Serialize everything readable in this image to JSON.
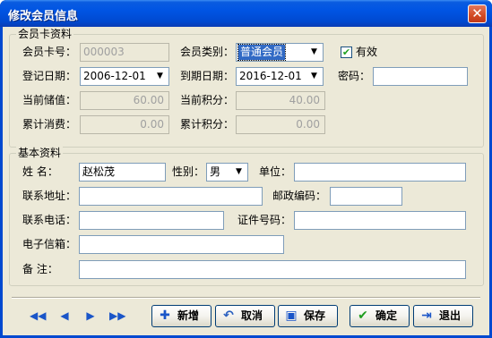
{
  "window": {
    "title": "修改会员信息",
    "close_symbol": "✕"
  },
  "card_group": {
    "title": "会员卡资料",
    "card_no_label": "会员卡号：",
    "card_no_value": "000003",
    "type_label": "会员类别：",
    "type_value": "普通会员",
    "valid_label": "有效",
    "valid_checked": true,
    "reg_date_label": "登记日期：",
    "reg_date_value": "2006-12-01",
    "expire_label": "到期日期：",
    "expire_value": "2016-12-01",
    "password_label": "密码：",
    "password_value": "",
    "balance_label": "当前储值：",
    "balance_value": "60.00",
    "points_label": "当前积分：",
    "points_value": "40.00",
    "total_spend_label": "累计消费：",
    "total_spend_value": "0.00",
    "total_points_label": "累计积分：",
    "total_points_value": "0.00"
  },
  "basic_group": {
    "title": "基本资料",
    "name_label": "姓    名：",
    "name_value": "赵松茂",
    "gender_label": "性别：",
    "gender_value": "男",
    "company_label": "单位：",
    "company_value": "",
    "address_label": "联系地址：",
    "address_value": "",
    "zip_label": "邮政编码：",
    "zip_value": "",
    "phone_label": "联系电话：",
    "phone_value": "",
    "id_label": "证件号码：",
    "id_value": "",
    "email_label": "电子信箱：",
    "email_value": "",
    "note_label": "备    注：",
    "note_value": ""
  },
  "toolbar": {
    "first_icon": "first-record-icon",
    "prev_icon": "prev-record-icon",
    "next_icon": "next-record-icon",
    "last_icon": "last-record-icon",
    "add_label": "新增",
    "cancel_label": "取消",
    "save_label": "保存",
    "ok_label": "确定",
    "exit_label": "退出"
  },
  "colors": {
    "title_bar": "#0054e3",
    "client": "#ece9d8",
    "selection": "#316ac5"
  }
}
